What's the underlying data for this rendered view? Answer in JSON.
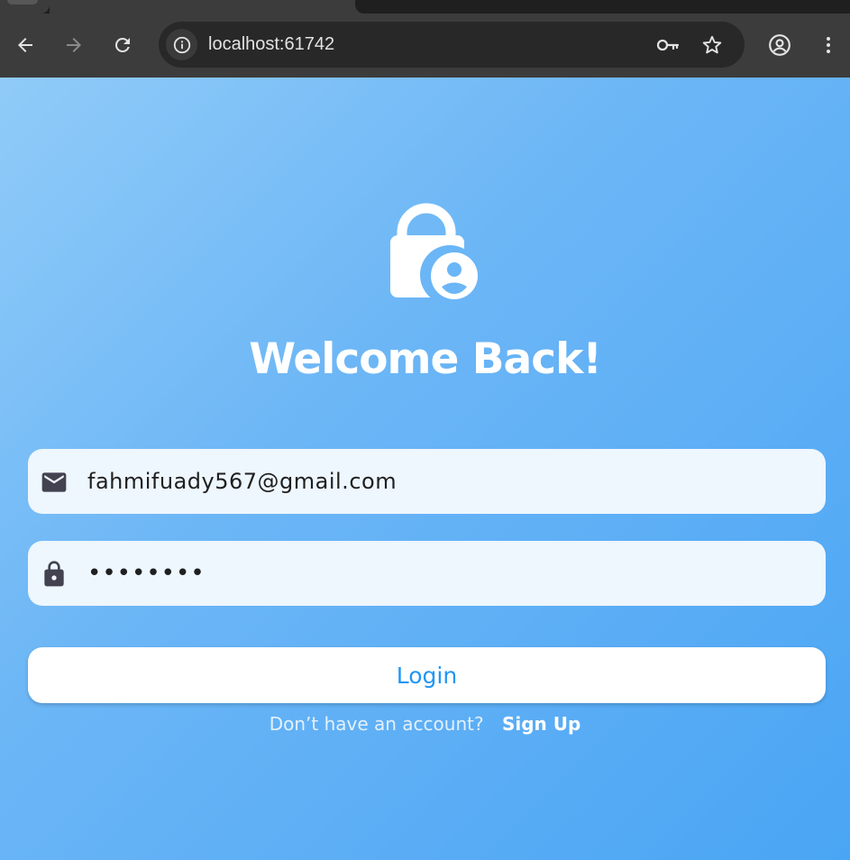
{
  "browser": {
    "url": "localhost:61742",
    "icons": {
      "back": "arrow-left-icon",
      "forward": "arrow-right-icon",
      "reload": "reload-icon",
      "site_info": "info-icon",
      "passwords": "key-icon",
      "bookmark": "star-icon",
      "profile": "account-circle-icon",
      "menu": "kebab-menu-icon"
    }
  },
  "login": {
    "logo_icon": "lock-person-icon",
    "title": "Welcome Back!",
    "email": {
      "icon": "email-icon",
      "value": "fahmifuady567@gmail.com"
    },
    "password": {
      "icon": "lock-icon",
      "value": "fahmi123"
    },
    "login_button": "Login",
    "signup_prompt": "Don’t have an account?",
    "signup_link": "Sign Up"
  },
  "colors": {
    "gradient_start": "#90cbf8",
    "gradient_end": "#4aa5f4",
    "accent": "#2196f3",
    "field_bg": "#eef6fe",
    "field_icon": "#424250"
  }
}
